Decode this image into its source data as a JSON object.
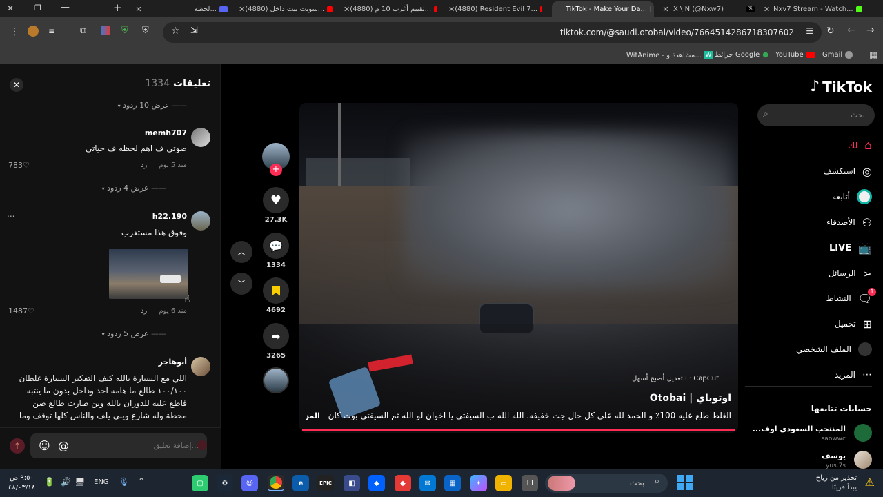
{
  "browser": {
    "tabs": [
      {
        "title": "لحظة...",
        "color": "#5865f2"
      },
      {
        "title": "(4880) سويت بيت داخل...",
        "color": "#ff0000"
      },
      {
        "title": "(4880) تقييم أغرب 10 م...",
        "color": "#ff0000"
      },
      {
        "title": "(4880) Resident Evil 7...",
        "color": "#ff0000"
      },
      {
        "title": "TikTok - Make Your Da...",
        "color": "#000000",
        "active": true
      },
      {
        "title": "X \\ N (@Nxw7)",
        "color": "#000000"
      },
      {
        "title": "Nxv7 Stream - Watch...",
        "color": "#53fc18"
      }
    ],
    "url": "tiktok.com/@saudi.otobai/video/7664514286718307602",
    "bookmarks": [
      "Gmail",
      "YouTube",
      "خرائط Google",
      "WitAnime - مشاهدة و..."
    ]
  },
  "comments_panel": {
    "title": "تعليقات",
    "count": "1334",
    "close_label": "✕",
    "items": [
      {
        "toggle": "عرض 10 ردود"
      },
      {
        "user": "memh707",
        "text": "صوتي ف اهم لحظه ف حياتي",
        "time": "منذ 5 يوم",
        "reply": "رد",
        "likes": "783"
      },
      {
        "toggle": "عرض 4 ردود"
      },
      {
        "user": "h22.190",
        "text": "وفوق هذا مستغرب",
        "time": "منذ 6 يوم",
        "reply": "رد",
        "likes": "1487"
      },
      {
        "toggle": "عرض 5 ردود"
      },
      {
        "user": "أبوهاجر",
        "text": "اللي مع السيارة بالله كيف التفكير السيارة غلطان ١٠٠/١٠٠ طالع ما هامه احد وداخل بدون ما ينتبه قاطع عليه للدوران بالله وين صارت طالع ضن محطة وله شارع ويبي يلف والناس كلها توقف وما"
      }
    ],
    "input_placeholder": "إضافة تعليق...",
    "mention_label": "@",
    "more_label": "..."
  },
  "video": {
    "capcut_label": "CapCut · التعديل أصبح أسهل",
    "author": "Otobai | اوتوباي",
    "caption": "الغلط طلع عليه 100٪ و الحمد لله على كل حال جت خفيفه. الله الله ب السيفتي يا اخوان لو الله ثم السيفتي بوت كان",
    "more_label": "المزيد"
  },
  "actions": {
    "likes": "27.3K",
    "comments": "1334",
    "saves": "4692",
    "shares": "3265"
  },
  "sidebar": {
    "logo": "TikTok",
    "search_placeholder": "بحث",
    "nav": [
      {
        "label": "لك",
        "icon": "home-icon"
      },
      {
        "label": "استكشف",
        "icon": "compass-icon"
      },
      {
        "label": "أتابعه",
        "icon": "following-icon"
      },
      {
        "label": "الأصدقاء",
        "icon": "friends-icon"
      },
      {
        "label": "LIVE",
        "icon": "live-icon"
      },
      {
        "label": "الرسائل",
        "icon": "messages-icon"
      },
      {
        "label": "النشاط",
        "icon": "activity-icon"
      },
      {
        "label": "تحميل",
        "icon": "upload-icon"
      },
      {
        "label": "الملف الشخصي",
        "icon": "profile-icon"
      },
      {
        "label": "المزيد",
        "icon": "more-icon"
      }
    ],
    "activity_badge": "1",
    "following_title": "حسابات تتابعها",
    "following": [
      {
        "name": "المنتخب السعودي اوف...",
        "handle": "saowwc"
      },
      {
        "name": "يوسف",
        "handle": "yus.7s"
      }
    ]
  },
  "taskbar": {
    "search_placeholder": "بحث",
    "weather_line1": "تحذير من رياح",
    "weather_line2": "يبدأ قريبًا",
    "lang": "ENG",
    "time": "٩:٥٠ ص",
    "date": "٤٨/٠٣/١٨"
  },
  "colors": {
    "accent": "#fe2c55",
    "bookmark_save": "#facd00"
  }
}
